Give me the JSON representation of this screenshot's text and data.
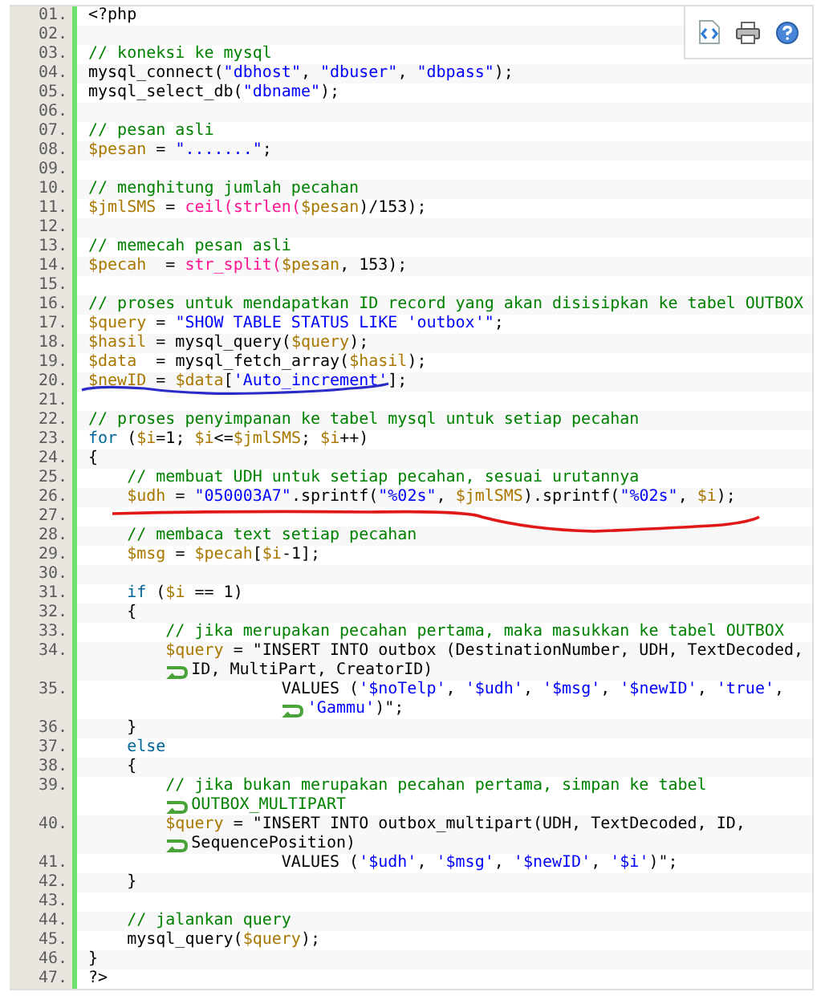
{
  "code_listing": {
    "lines": [
      {
        "number": "01.",
        "tokens": [
          {
            "text": "<?php",
            "kind": "plain"
          }
        ]
      },
      {
        "number": "02."
      },
      {
        "number": "03.",
        "tokens": [
          {
            "text": "// koneksi ke mysql",
            "kind": "comment"
          }
        ]
      },
      {
        "number": "04.",
        "tokens": [
          {
            "text": "mysql_connect(",
            "kind": "plain"
          },
          {
            "text": "\"dbhost\"",
            "kind": "string"
          },
          {
            "text": ", ",
            "kind": "plain"
          },
          {
            "text": "\"dbuser\"",
            "kind": "string"
          },
          {
            "text": ", ",
            "kind": "plain"
          },
          {
            "text": "\"dbpass\"",
            "kind": "string"
          },
          {
            "text": ");",
            "kind": "plain"
          }
        ]
      },
      {
        "number": "05.",
        "tokens": [
          {
            "text": "mysql_select_db(",
            "kind": "plain"
          },
          {
            "text": "\"dbname\"",
            "kind": "string"
          },
          {
            "text": ");",
            "kind": "plain"
          }
        ]
      },
      {
        "number": "06."
      },
      {
        "number": "07.",
        "tokens": [
          {
            "text": "// pesan asli",
            "kind": "comment"
          }
        ]
      },
      {
        "number": "08.",
        "tokens": [
          {
            "text": "$pesan",
            "kind": "variable"
          },
          {
            "text": " = ",
            "kind": "plain"
          },
          {
            "text": "\".......\"",
            "kind": "string"
          },
          {
            "text": ";",
            "kind": "plain"
          }
        ]
      },
      {
        "number": "09."
      },
      {
        "number": "10.",
        "tokens": [
          {
            "text": "// menghitung jumlah pecahan",
            "kind": "comment"
          }
        ]
      },
      {
        "number": "11.",
        "tokens": [
          {
            "text": "$jmlSMS",
            "kind": "variable"
          },
          {
            "text": " = ",
            "kind": "plain"
          },
          {
            "text": "ceil(strlen(",
            "kind": "function"
          },
          {
            "text": "$pesan",
            "kind": "variable"
          },
          {
            "text": ")/153);",
            "kind": "plain"
          }
        ]
      },
      {
        "number": "12."
      },
      {
        "number": "13.",
        "tokens": [
          {
            "text": "// memecah pesan asli",
            "kind": "comment"
          }
        ]
      },
      {
        "number": "14.",
        "tokens": [
          {
            "text": "$pecah",
            "kind": "variable"
          },
          {
            "text": "  = ",
            "kind": "plain"
          },
          {
            "text": "str_split(",
            "kind": "function"
          },
          {
            "text": "$pesan",
            "kind": "variable"
          },
          {
            "text": ", 153);",
            "kind": "plain"
          }
        ]
      },
      {
        "number": "15."
      },
      {
        "number": "16.",
        "tokens": [
          {
            "text": "// proses untuk mendapatkan ID record yang akan disisipkan ke tabel OUTBOX",
            "kind": "comment"
          }
        ]
      },
      {
        "number": "17.",
        "tokens": [
          {
            "text": "$query",
            "kind": "variable"
          },
          {
            "text": " = ",
            "kind": "plain"
          },
          {
            "text": "\"SHOW TABLE STATUS LIKE 'outbox'\"",
            "kind": "string"
          },
          {
            "text": ";",
            "kind": "plain"
          }
        ]
      },
      {
        "number": "18.",
        "tokens": [
          {
            "text": "$hasil",
            "kind": "variable"
          },
          {
            "text": " = mysql_query(",
            "kind": "plain"
          },
          {
            "text": "$query",
            "kind": "variable"
          },
          {
            "text": ");",
            "kind": "plain"
          }
        ]
      },
      {
        "number": "19.",
        "tokens": [
          {
            "text": "$data",
            "kind": "variable"
          },
          {
            "text": "  = mysql_fetch_array(",
            "kind": "plain"
          },
          {
            "text": "$hasil",
            "kind": "variable"
          },
          {
            "text": ");",
            "kind": "plain"
          }
        ]
      },
      {
        "number": "20.",
        "tokens": [
          {
            "text": "$newID",
            "kind": "variable"
          },
          {
            "text": " = ",
            "kind": "plain"
          },
          {
            "text": "$data",
            "kind": "variable"
          },
          {
            "text": "[",
            "kind": "plain"
          },
          {
            "text": "'Auto_increment'",
            "kind": "string"
          },
          {
            "text": "];",
            "kind": "plain"
          }
        ]
      },
      {
        "number": "21."
      },
      {
        "number": "22.",
        "tokens": [
          {
            "text": "// proses penyimpanan ke tabel mysql untuk setiap pecahan",
            "kind": "comment"
          }
        ]
      },
      {
        "number": "23.",
        "tokens": [
          {
            "text": "for",
            "kind": "keyword"
          },
          {
            "text": " (",
            "kind": "plain"
          },
          {
            "text": "$i",
            "kind": "variable"
          },
          {
            "text": "=1; ",
            "kind": "plain"
          },
          {
            "text": "$i",
            "kind": "variable"
          },
          {
            "text": "<=",
            "kind": "plain"
          },
          {
            "text": "$jmlSMS",
            "kind": "variable"
          },
          {
            "text": "; ",
            "kind": "plain"
          },
          {
            "text": "$i",
            "kind": "variable"
          },
          {
            "text": "++)",
            "kind": "plain"
          }
        ]
      },
      {
        "number": "24.",
        "tokens": [
          {
            "text": "{",
            "kind": "plain"
          }
        ]
      },
      {
        "number": "25.",
        "tokens": [
          {
            "text": "    // membuat UDH untuk setiap pecahan, sesuai urutannya",
            "kind": "comment"
          }
        ]
      },
      {
        "number": "26.",
        "tokens": [
          {
            "text": "    $udh",
            "kind": "variable"
          },
          {
            "text": " = ",
            "kind": "plain"
          },
          {
            "text": "\"050003A7\"",
            "kind": "string"
          },
          {
            "text": ".sprintf(",
            "kind": "plain"
          },
          {
            "text": "\"%02s\"",
            "kind": "string"
          },
          {
            "text": ", ",
            "kind": "plain"
          },
          {
            "text": "$jmlSMS",
            "kind": "variable"
          },
          {
            "text": ").sprintf(",
            "kind": "plain"
          },
          {
            "text": "\"%02s\"",
            "kind": "string"
          },
          {
            "text": ", ",
            "kind": "plain"
          },
          {
            "text": "$i",
            "kind": "variable"
          },
          {
            "text": ");",
            "kind": "plain"
          }
        ]
      },
      {
        "number": "27."
      },
      {
        "number": "28.",
        "tokens": [
          {
            "text": "    // membaca text setiap pecahan",
            "kind": "comment"
          }
        ]
      },
      {
        "number": "29.",
        "tokens": [
          {
            "text": "    $msg",
            "kind": "variable"
          },
          {
            "text": " = ",
            "kind": "plain"
          },
          {
            "text": "$pecah",
            "kind": "variable"
          },
          {
            "text": "[",
            "kind": "plain"
          },
          {
            "text": "$i",
            "kind": "variable"
          },
          {
            "text": "-1];",
            "kind": "plain"
          }
        ]
      },
      {
        "number": "30."
      },
      {
        "number": "31.",
        "tokens": [
          {
            "text": "    if",
            "kind": "keyword"
          },
          {
            "text": " (",
            "kind": "plain"
          },
          {
            "text": "$i",
            "kind": "variable"
          },
          {
            "text": " == 1)",
            "kind": "plain"
          }
        ]
      },
      {
        "number": "32.",
        "tokens": [
          {
            "text": "    {",
            "kind": "plain"
          }
        ]
      },
      {
        "number": "33.",
        "tokens": [
          {
            "text": "        // jika merupakan pecahan pertama, maka masukkan ke tabel OUTBOX",
            "kind": "comment"
          }
        ]
      },
      {
        "number": "34.",
        "tokens": [
          {
            "text": "        $query",
            "kind": "variable"
          },
          {
            "text": " = \"INSERT INTO outbox (DestinationNumber, UDH, TextDecoded,",
            "kind": "plain"
          }
        ],
        "continuation": [
          {
            "text": "ID, MultiPart, CreatorID)",
            "kind": "plain"
          }
        ]
      },
      {
        "number": "35.",
        "tokens": [
          {
            "text": "                    VALUES (",
            "kind": "plain"
          },
          {
            "text": "'$noTelp'",
            "kind": "string"
          },
          {
            "text": ", ",
            "kind": "plain"
          },
          {
            "text": "'$udh'",
            "kind": "string"
          },
          {
            "text": ", ",
            "kind": "plain"
          },
          {
            "text": "'$msg'",
            "kind": "string"
          },
          {
            "text": ", ",
            "kind": "plain"
          },
          {
            "text": "'$newID'",
            "kind": "string"
          },
          {
            "text": ", ",
            "kind": "plain"
          },
          {
            "text": "'true'",
            "kind": "string"
          },
          {
            "text": ",",
            "kind": "plain"
          }
        ],
        "continuation": [
          {
            "text": "'Gammu'",
            "kind": "string"
          },
          {
            "text": ")\";",
            "kind": "plain"
          }
        ]
      },
      {
        "number": "36.",
        "tokens": [
          {
            "text": "    }",
            "kind": "plain"
          }
        ]
      },
      {
        "number": "37.",
        "tokens": [
          {
            "text": "    else",
            "kind": "keyword"
          }
        ]
      },
      {
        "number": "38.",
        "tokens": [
          {
            "text": "    {",
            "kind": "plain"
          }
        ]
      },
      {
        "number": "39.",
        "tokens": [
          {
            "text": "        // jika bukan merupakan pecahan pertama, simpan ke tabel",
            "kind": "comment"
          }
        ],
        "continuation": [
          {
            "text": "OUTBOX_MULTIPART",
            "kind": "comment"
          }
        ]
      },
      {
        "number": "40.",
        "tokens": [
          {
            "text": "        $query",
            "kind": "variable"
          },
          {
            "text": " = \"INSERT INTO outbox_multipart(UDH, TextDecoded, ID,",
            "kind": "plain"
          }
        ],
        "continuation": [
          {
            "text": "SequencePosition)",
            "kind": "plain"
          }
        ]
      },
      {
        "number": "41.",
        "tokens": [
          {
            "text": "                    VALUES (",
            "kind": "plain"
          },
          {
            "text": "'$udh'",
            "kind": "string"
          },
          {
            "text": ", ",
            "kind": "plain"
          },
          {
            "text": "'$msg'",
            "kind": "string"
          },
          {
            "text": ", ",
            "kind": "plain"
          },
          {
            "text": "'$newID'",
            "kind": "string"
          },
          {
            "text": ", ",
            "kind": "plain"
          },
          {
            "text": "'$i'",
            "kind": "string"
          },
          {
            "text": ")\";",
            "kind": "plain"
          }
        ]
      },
      {
        "number": "42.",
        "tokens": [
          {
            "text": "    }",
            "kind": "plain"
          }
        ]
      },
      {
        "number": "43."
      },
      {
        "number": "44.",
        "tokens": [
          {
            "text": "    // jalankan query",
            "kind": "comment"
          }
        ]
      },
      {
        "number": "45.",
        "tokens": [
          {
            "text": "    mysql_query(",
            "kind": "plain"
          },
          {
            "text": "$query",
            "kind": "variable"
          },
          {
            "text": ");",
            "kind": "plain"
          }
        ]
      },
      {
        "number": "46.",
        "tokens": [
          {
            "text": "}",
            "kind": "plain"
          }
        ]
      },
      {
        "number": "47.",
        "tokens": [
          {
            "text": "?>",
            "kind": "plain"
          }
        ]
      }
    ]
  }
}
